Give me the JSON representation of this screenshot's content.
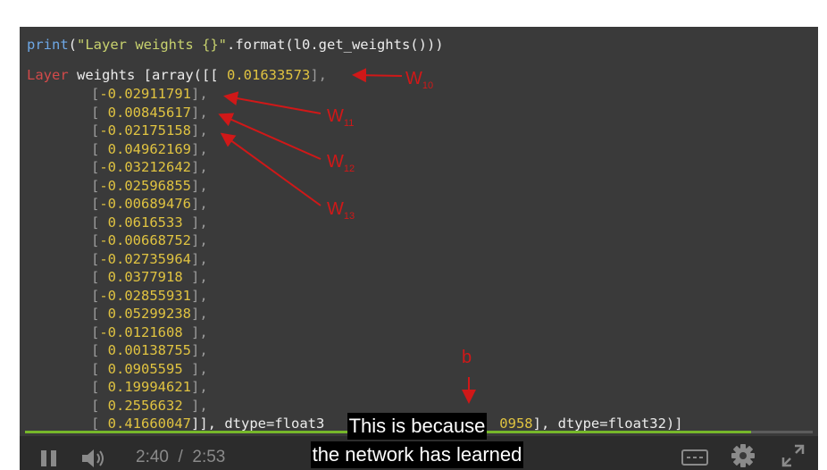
{
  "code": {
    "print_fn": "print",
    "print_str": "\"Layer weights {}\"",
    "print_rest": ".format(l0.get_weights()))",
    "open_paren": "(",
    "output_label": "Layer",
    "output_head": " weights [array([[",
    "first_value": " 0.01633573",
    "values": [
      "-0.02911791",
      " 0.00845617",
      "-0.02175158",
      " 0.04962169",
      "-0.03212642",
      "-0.02596855",
      "-0.00689476",
      " 0.0616533 ",
      "-0.00668752",
      "-0.02735964",
      " 0.0377918 ",
      "-0.02855931",
      " 0.05299238",
      "-0.0121608 ",
      " 0.00138755",
      " 0.0905595 ",
      " 0.19994621",
      " 0.2556632 ",
      " 0.41660047"
    ],
    "last_suffix": "]], dtype=float3",
    "bias_tail": "0958",
    "bias_suffix": "], dtype=float32)]"
  },
  "annotations": {
    "w10": "W10",
    "w11": "W11",
    "w12": "W12",
    "w13": "W13",
    "bias": "b",
    "color": "#d01818"
  },
  "player": {
    "current_time": "2:40",
    "separator": "/",
    "duration": "2:53",
    "progress": 0.922,
    "progress_color": "#76b72a",
    "icons": [
      "pause-icon",
      "volume-icon",
      "captions-icon",
      "settings-icon",
      "fullscreen-icon"
    ]
  },
  "captions": {
    "line1": "This is because",
    "line2": "the network has learned"
  }
}
